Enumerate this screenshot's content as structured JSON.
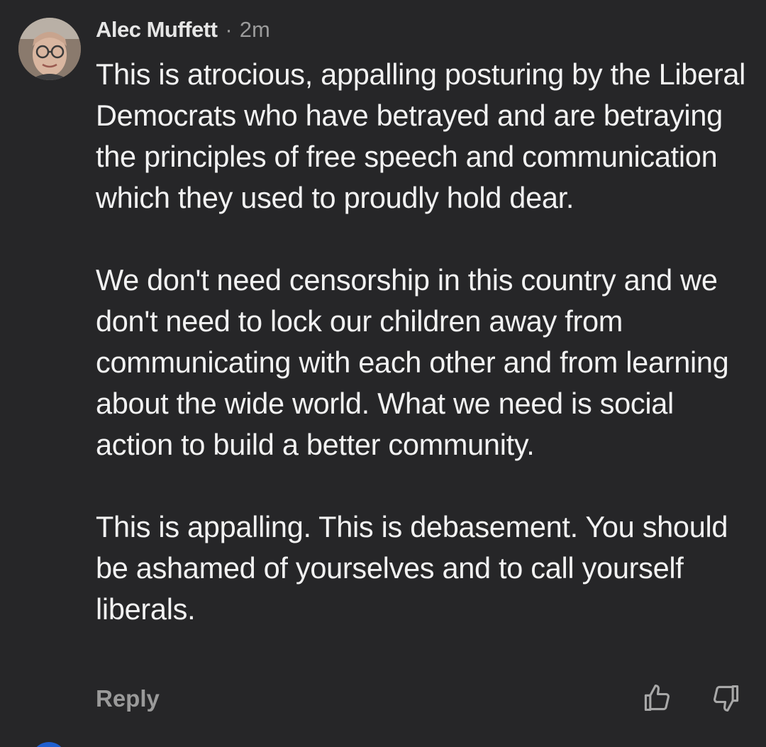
{
  "comment": {
    "author": "Alec Muffett",
    "separator": "·",
    "time": "2m",
    "paragraphs": [
      "This is atrocious, appalling posturing by the Liberal Democrats who have betrayed and are betraying the principles of free speech and communication which they used to proudly hold dear.",
      "We don't need censorship in this country and we don't need to lock our children away from communicating with each other and from learning about the wide world. What we need is social action to build a better community.",
      "This is appalling. This is debasement. You should be ashamed of yourselves and to call yourself liberals."
    ],
    "reply_label": "Reply",
    "avatar_icon": "user-avatar",
    "upvote_icon": "thumbs-up-icon",
    "downvote_icon": "thumbs-down-icon"
  },
  "colors": {
    "background": "#262628",
    "text": "#f2f2f2",
    "muted": "#9b9b9b"
  }
}
